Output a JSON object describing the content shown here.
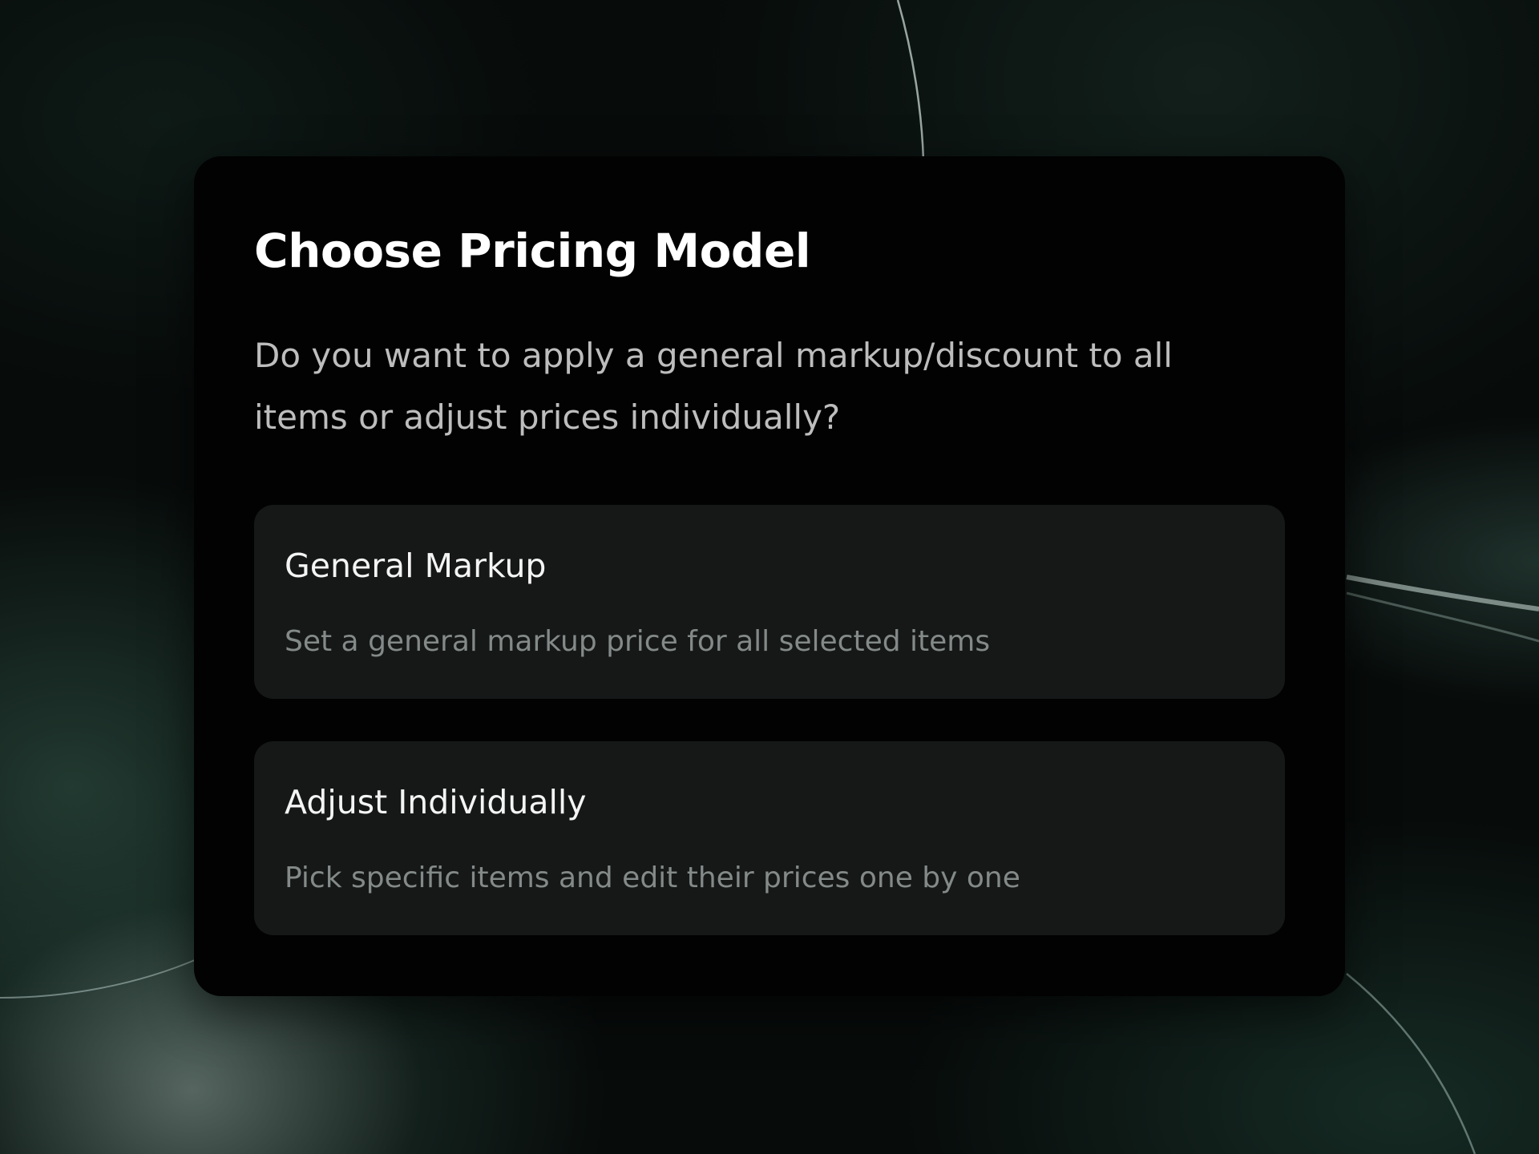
{
  "dialog": {
    "title": "Choose Pricing Model",
    "subtitle": "Do you want to apply a general markup/discount to all items or adjust prices individually?"
  },
  "options": [
    {
      "title": "General Markup",
      "description": "Set a general markup price for all selected items"
    },
    {
      "title": "Adjust Individually",
      "description": "Pick specific items and edit their prices one by one"
    }
  ],
  "colors": {
    "card_background": "#020202",
    "option_background": "#161818",
    "title_text": "#ffffff",
    "subtitle_text": "#bdbdbd",
    "option_description_text": "#838a88",
    "backdrop_accent": "#3a5f54"
  }
}
